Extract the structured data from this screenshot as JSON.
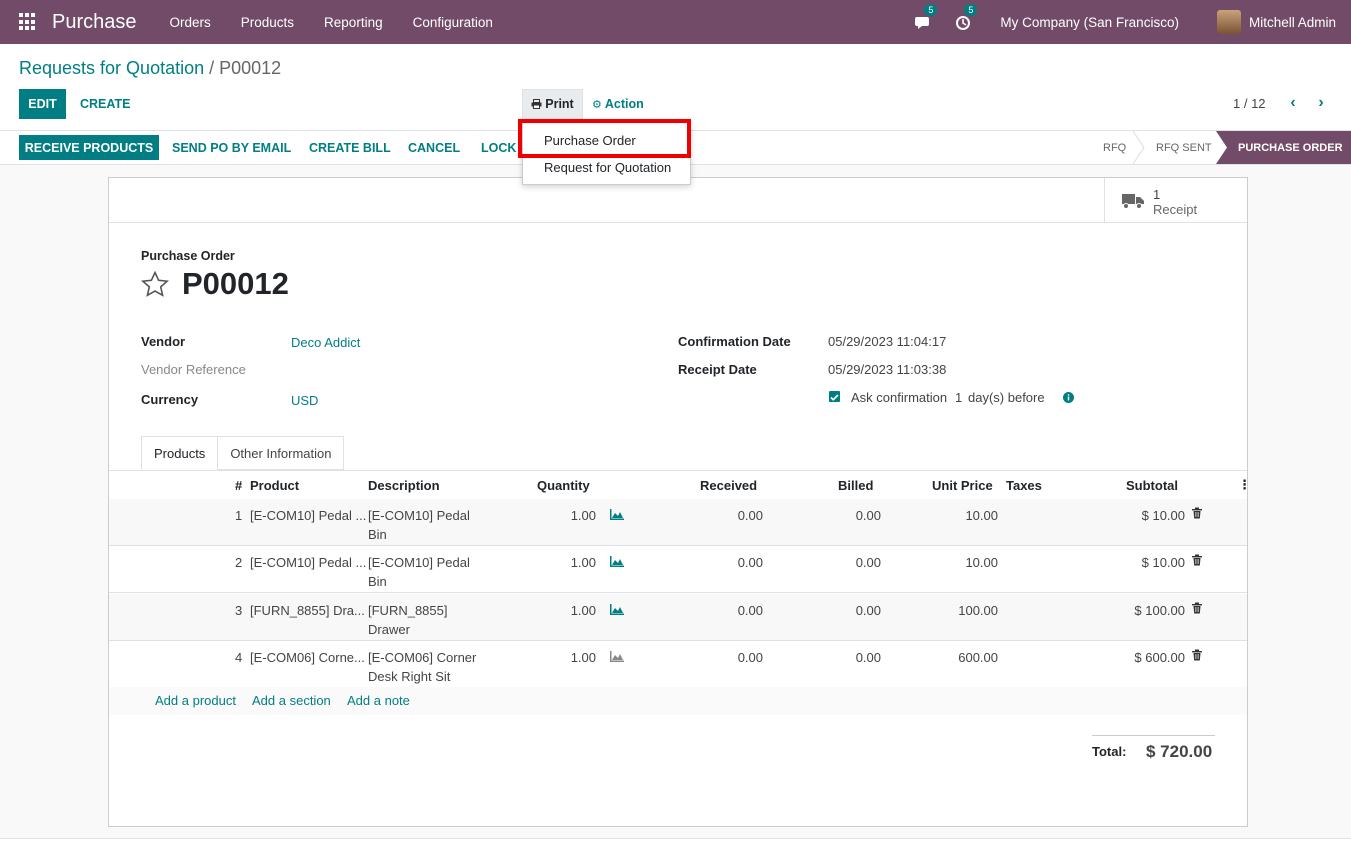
{
  "nav": {
    "app_name": "Purchase",
    "menu": [
      "Orders",
      "Products",
      "Reporting",
      "Configuration"
    ],
    "messages_badge": "5",
    "activities_badge": "5",
    "company": "My Company (San Francisco)",
    "user": "Mitchell Admin"
  },
  "breadcrumb": {
    "parent": "Requests for Quotation",
    "separator": " / ",
    "current": "P00012"
  },
  "toolbar": {
    "edit": "EDIT",
    "create": "CREATE",
    "print": "Print",
    "action": "Action",
    "pager": "1 / 12"
  },
  "print_menu": {
    "items": [
      "Purchase Order",
      "Request for Quotation"
    ]
  },
  "statusbar": {
    "buttons": [
      "RECEIVE PRODUCTS",
      "SEND PO BY EMAIL",
      "CREATE BILL",
      "CANCEL",
      "LOCK"
    ],
    "stages": [
      "RFQ",
      "RFQ SENT",
      "PURCHASE ORDER"
    ],
    "active_stage": "PURCHASE ORDER"
  },
  "smart_button": {
    "count": "1",
    "label": "Receipt"
  },
  "form": {
    "doc_type": "Purchase Order",
    "name": "P00012",
    "vendor_label": "Vendor",
    "vendor": "Deco Addict",
    "vendor_ref_label": "Vendor Reference",
    "currency_label": "Currency",
    "currency": "USD",
    "confirmation_date_label": "Confirmation Date",
    "confirmation_date": "05/29/2023 11:04:17",
    "receipt_date_label": "Receipt Date",
    "receipt_date": "05/29/2023 11:03:38",
    "ask_confirmation": "Ask confirmation",
    "ask_days": "1",
    "ask_suffix": "day(s) before"
  },
  "tabs": [
    "Products",
    "Other Information"
  ],
  "table": {
    "headers": [
      "#",
      "Product",
      "Description",
      "Quantity",
      "Received",
      "Billed",
      "Unit Price",
      "Taxes",
      "Subtotal"
    ],
    "rows": [
      {
        "num": "1",
        "product": "[E-COM10] Pedal ...",
        "desc1": "[E-COM10] Pedal",
        "desc2": "Bin",
        "qty": "1.00",
        "received": "0.00",
        "billed": "0.00",
        "price": "10.00",
        "subtotal": "$ 10.00"
      },
      {
        "num": "2",
        "product": "[E-COM10] Pedal ...",
        "desc1": "[E-COM10] Pedal",
        "desc2": "Bin",
        "qty": "1.00",
        "received": "0.00",
        "billed": "0.00",
        "price": "10.00",
        "subtotal": "$ 10.00"
      },
      {
        "num": "3",
        "product": "[FURN_8855] Dra...",
        "desc1": "[FURN_8855]",
        "desc2": "Drawer",
        "qty": "1.00",
        "received": "0.00",
        "billed": "0.00",
        "price": "100.00",
        "subtotal": "$ 100.00"
      },
      {
        "num": "4",
        "product": "[E-COM06] Corne...",
        "desc1": "[E-COM06] Corner",
        "desc2": "Desk Right Sit",
        "qty": "1.00",
        "received": "0.00",
        "billed": "0.00",
        "price": "600.00",
        "subtotal": "$ 600.00"
      }
    ],
    "add_product": "Add a product",
    "add_section": "Add a section",
    "add_note": "Add a note"
  },
  "totals": {
    "label": "Total:",
    "value": "$ 720.00"
  },
  "colors": {
    "brand": "#714b67",
    "accent": "#017e84",
    "highlight": "#ee0000"
  }
}
